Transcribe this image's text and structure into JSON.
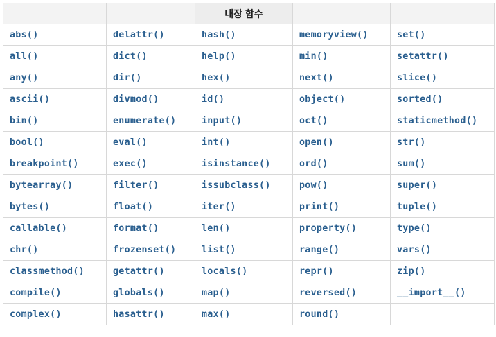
{
  "table": {
    "header": [
      "",
      "",
      "내장 함수",
      "",
      ""
    ],
    "columns": [
      [
        "abs()",
        "all()",
        "any()",
        "ascii()",
        "bin()",
        "bool()",
        "breakpoint()",
        "bytearray()",
        "bytes()",
        "callable()",
        "chr()",
        "classmethod()",
        "compile()",
        "complex()"
      ],
      [
        "delattr()",
        "dict()",
        "dir()",
        "divmod()",
        "enumerate()",
        "eval()",
        "exec()",
        "filter()",
        "float()",
        "format()",
        "frozenset()",
        "getattr()",
        "globals()",
        "hasattr()"
      ],
      [
        "hash()",
        "help()",
        "hex()",
        "id()",
        "input()",
        "int()",
        "isinstance()",
        "issubclass()",
        "iter()",
        "len()",
        "list()",
        "locals()",
        "map()",
        "max()"
      ],
      [
        "memoryview()",
        "min()",
        "next()",
        "object()",
        "oct()",
        "open()",
        "ord()",
        "pow()",
        "print()",
        "property()",
        "range()",
        "repr()",
        "reversed()",
        "round()"
      ],
      [
        "set()",
        "setattr()",
        "slice()",
        "sorted()",
        "staticmethod()",
        "str()",
        "sum()",
        "super()",
        "tuple()",
        "type()",
        "vars()",
        "zip()",
        "__import__()",
        ""
      ]
    ]
  }
}
